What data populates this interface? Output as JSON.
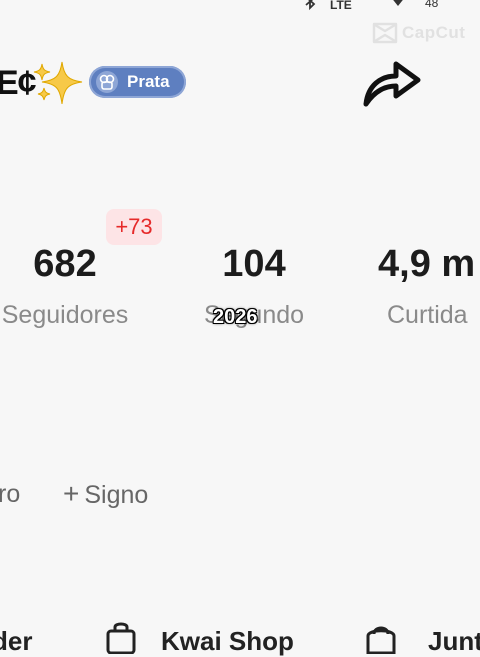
{
  "status_bar": {
    "network_label": "LTE",
    "battery_label": "48",
    "icons": [
      "bluetooth-icon",
      "wifi-icon",
      "battery-icon"
    ]
  },
  "watermark": {
    "text": "CapCut"
  },
  "profile": {
    "name_fragment": "E¢",
    "name_emoji": "✨",
    "tier_badge": "Prata",
    "share_icon": "share-arrow-icon"
  },
  "stats": {
    "followers": {
      "value": "682",
      "label": "Seguidores",
      "delta": "+73"
    },
    "following": {
      "value": "104",
      "label": "Segundo"
    },
    "likes": {
      "value": "4,9 m",
      "label": "Curtida"
    }
  },
  "overlay": {
    "year": "2026"
  },
  "chips": {
    "left_fragment": "ro",
    "add_sign_label": "Signo",
    "add_icon": "plus-icon"
  },
  "bottom_tabs": {
    "left_fragment": "der",
    "shop_label": "Kwai Shop",
    "join_label": "Junt",
    "shop_icon": "shopping-bag-icon",
    "join_icon": "bag-icon"
  },
  "colors": {
    "background": "#f7f7f7",
    "badge_blue": "#5e7fc0",
    "delta_red": "#e62a2a",
    "delta_bg": "#fde4e6",
    "label_gray": "#8a8a8a"
  }
}
